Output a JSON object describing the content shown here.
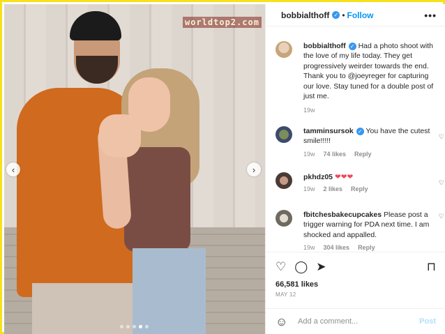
{
  "watermark": "worldtop2.com",
  "post": {
    "username": "bobbialthoff",
    "follow_label": "Follow",
    "separator": "•",
    "more_label": "•••",
    "caption": {
      "username": "bobbialthoff",
      "text": "Had a photo shoot with the love of my life today. They get progressively weirder towards the end. Thank you to @joeyreger for capturing our love. Stay tuned for a double post of just me.",
      "age": "19w"
    },
    "comments": [
      {
        "username": "tamminsursok",
        "verified": true,
        "text": "You have the cutest smile!!!!!",
        "age": "19w",
        "likes": "74 likes",
        "reply": "Reply"
      },
      {
        "username": "pkhdz05",
        "verified": false,
        "text": "❤❤❤",
        "age": "19w",
        "likes": "2 likes",
        "reply": "Reply"
      },
      {
        "username": "fbitchesbakecupcakes",
        "verified": false,
        "text": "Please post a trigger warning for PDA next time. I am shocked and appalled.",
        "age": "19w",
        "likes": "304 likes",
        "reply": "Reply"
      }
    ],
    "like_count": "66,581 likes",
    "date": "MAY 12",
    "add_comment_placeholder": "Add a comment...",
    "post_label": "Post"
  },
  "carousel": {
    "dots": 5,
    "active_index": 3,
    "prev_icon": "‹",
    "next_icon": "›"
  },
  "colors": {
    "accent": "#0095f6",
    "verified": "#3897f0",
    "frame": "#f7e11b"
  }
}
